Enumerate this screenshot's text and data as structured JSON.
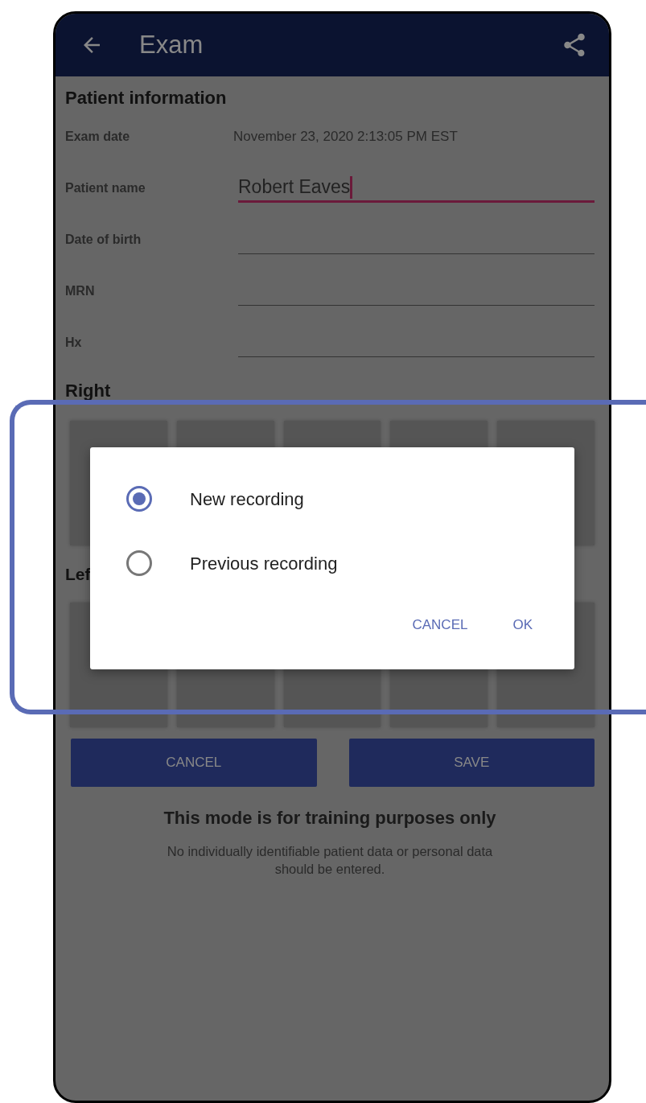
{
  "header": {
    "title": "Exam"
  },
  "patient_information": {
    "heading": "Patient information",
    "fields": [
      {
        "label": "Exam date",
        "kind": "static",
        "value": "November 23, 2020 2:13:05 PM EST"
      },
      {
        "label": "Patient name",
        "kind": "input",
        "value": "Robert Eaves",
        "focused": true
      },
      {
        "label": "Date of birth",
        "kind": "input",
        "focused": false
      },
      {
        "label": "MRN",
        "kind": "input",
        "focused": false
      },
      {
        "label": "Hx",
        "kind": "input",
        "focused": false
      }
    ]
  },
  "eyes": [
    {
      "heading": "Right"
    },
    {
      "heading": "Lef"
    }
  ],
  "buttons": [
    {
      "label": "CANCEL"
    },
    {
      "label": "SAVE"
    }
  ],
  "notice": {
    "title": "This mode is for training purposes only",
    "text": "No individually identifiable patient data or personal data should be entered."
  },
  "dialog": {
    "options": [
      {
        "label": "New recording",
        "selected": true
      },
      {
        "label": "Previous recording",
        "selected": false
      }
    ],
    "actions": [
      "CANCEL",
      "OK"
    ]
  },
  "highlight": true
}
